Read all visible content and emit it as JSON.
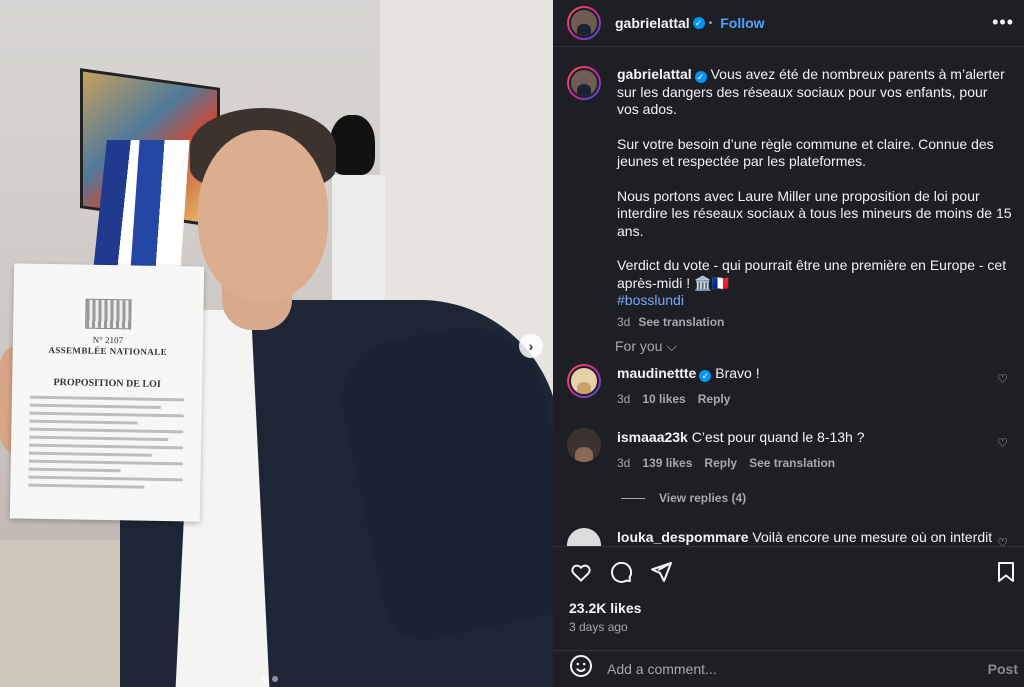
{
  "post": {
    "username": "gabrielattal",
    "verified_mark": "✓",
    "separator": "•",
    "follow_label": "Follow",
    "more_label": "•••",
    "caption_paragraphs": [
      "Vous avez été de nombreux parents à m’alerter sur les dangers des réseaux sociaux pour vos enfants, pour vos ados.",
      "Sur votre besoin d’une règle commune et claire. Connue des jeunes et respectée par les plateformes.",
      "Nous portons avec Laure Miller une proposition de loi pour interdire les réseaux sociaux à tous les mineurs de moins de 15 ans.",
      "Verdict du vote - qui pourrait être une première en Europe - cet après-midi ! 🏛️🇫🇷"
    ],
    "hashtag": "#bosslundi",
    "caption_age": "3d",
    "see_translation": "See translation",
    "likes": "23.2K likes",
    "date": "3 days ago"
  },
  "media": {
    "document": {
      "number": "N° 2107",
      "assembly": "ASSEMBLÉE NATIONALE",
      "title": "PROPOSITION DE LOI"
    },
    "next_arrow": "›"
  },
  "comments_section": {
    "for_you_label": "For you ⌵",
    "comments": [
      {
        "user": "maudinettte",
        "verified": true,
        "text": "Bravo !",
        "age": "3d",
        "likes": "10 likes",
        "reply": "Reply"
      },
      {
        "user": "ismaaa23k",
        "verified": false,
        "text": "C’est pour quand le 8-13h ?",
        "age": "3d",
        "likes": "139 likes",
        "reply": "Reply",
        "translate": "See translation"
      },
      {
        "user": "louka_despommare",
        "verified": false,
        "text": "Voilà encore une mesure où on interdit"
      }
    ],
    "view_replies": "View replies (4)"
  },
  "composer": {
    "placeholder": "Add a comment...",
    "post_label": "Post"
  },
  "icons": [
    "heart-icon",
    "comment-icon",
    "share-icon",
    "bookmark-icon",
    "emoji-icon",
    "more-icon",
    "verified-icon",
    "chevron-right-icon"
  ]
}
